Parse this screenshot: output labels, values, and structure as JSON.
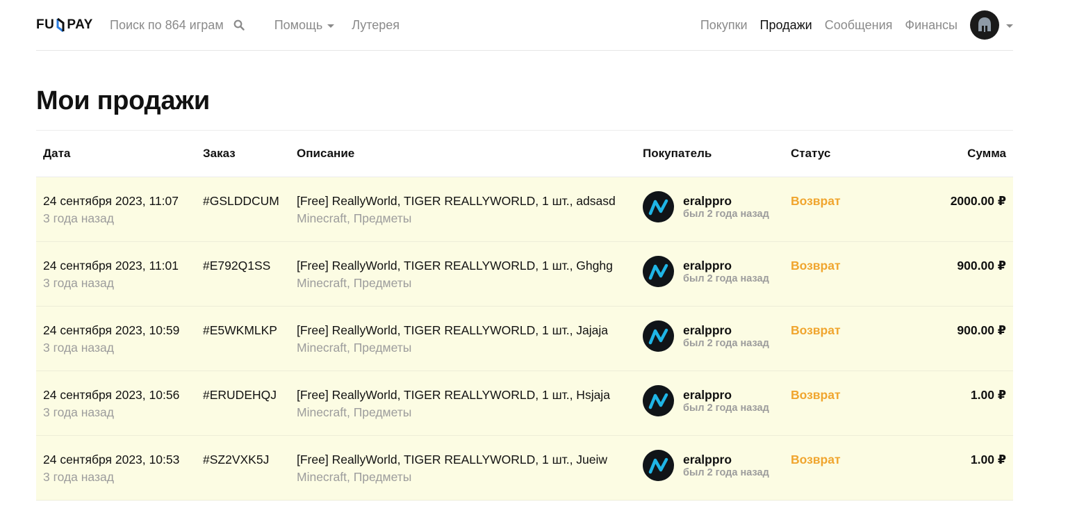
{
  "header": {
    "logo_left": "FU",
    "logo_right": "PAY",
    "search_label": "Поиск по 864 играм",
    "help_label": "Помощь",
    "lottery_label": "Лутерея",
    "nav": [
      "Покупки",
      "Продажи",
      "Сообщения",
      "Финансы"
    ],
    "active_nav": "Продажи"
  },
  "page": {
    "title": "Мои продажи"
  },
  "table": {
    "headers": {
      "date": "Дата",
      "order": "Заказ",
      "desc": "Описание",
      "buyer": "Покупатель",
      "status": "Статус",
      "sum": "Сумма"
    },
    "rows": [
      {
        "date": "24 сентября 2023, 11:07",
        "ago": "3 года назад",
        "order": "#GSLDDCUM",
        "desc": "[Free] ReallyWorld, TIGER REALLYWORLD, 1 шт., adsasd",
        "category": "Minecraft, Предметы",
        "buyer": "eralppro",
        "seen": "был 2 года назад",
        "status": "Возврат",
        "sum": "2000.00 ₽"
      },
      {
        "date": "24 сентября 2023, 11:01",
        "ago": "3 года назад",
        "order": "#E792Q1SS",
        "desc": "[Free] ReallyWorld, TIGER REALLYWORLD, 1 шт., Ghghg",
        "category": "Minecraft, Предметы",
        "buyer": "eralppro",
        "seen": "был 2 года назад",
        "status": "Возврат",
        "sum": "900.00 ₽"
      },
      {
        "date": "24 сентября 2023, 10:59",
        "ago": "3 года назад",
        "order": "#E5WKMLKP",
        "desc": "[Free] ReallyWorld, TIGER REALLYWORLD, 1 шт., Jajaja",
        "category": "Minecraft, Предметы",
        "buyer": "eralppro",
        "seen": "был 2 года назад",
        "status": "Возврат",
        "sum": "900.00 ₽"
      },
      {
        "date": "24 сентября 2023, 10:56",
        "ago": "3 года назад",
        "order": "#ERUDEHQJ",
        "desc": "[Free] ReallyWorld, TIGER REALLYWORLD, 1 шт., Hsjaja",
        "category": "Minecraft, Предметы",
        "buyer": "eralppro",
        "seen": "был 2 года назад",
        "status": "Возврат",
        "sum": "1.00 ₽"
      },
      {
        "date": "24 сентября 2023, 10:53",
        "ago": "3 года назад",
        "order": "#SZ2VXK5J",
        "desc": "[Free] ReallyWorld, TIGER REALLYWORLD, 1 шт., Jueiw",
        "category": "Minecraft, Предметы",
        "buyer": "eralppro",
        "seen": "был 2 года назад",
        "status": "Возврат",
        "sum": "1.00 ₽"
      }
    ]
  },
  "colors": {
    "row_bg": "#fcfce3",
    "status": "#f0a52e",
    "muted": "#9c9c9c",
    "logo_accent": "#2a7de1"
  },
  "icons": [
    "search-icon",
    "caret-down-icon",
    "helmet-avatar-icon",
    "buyer-avatar-icon"
  ]
}
